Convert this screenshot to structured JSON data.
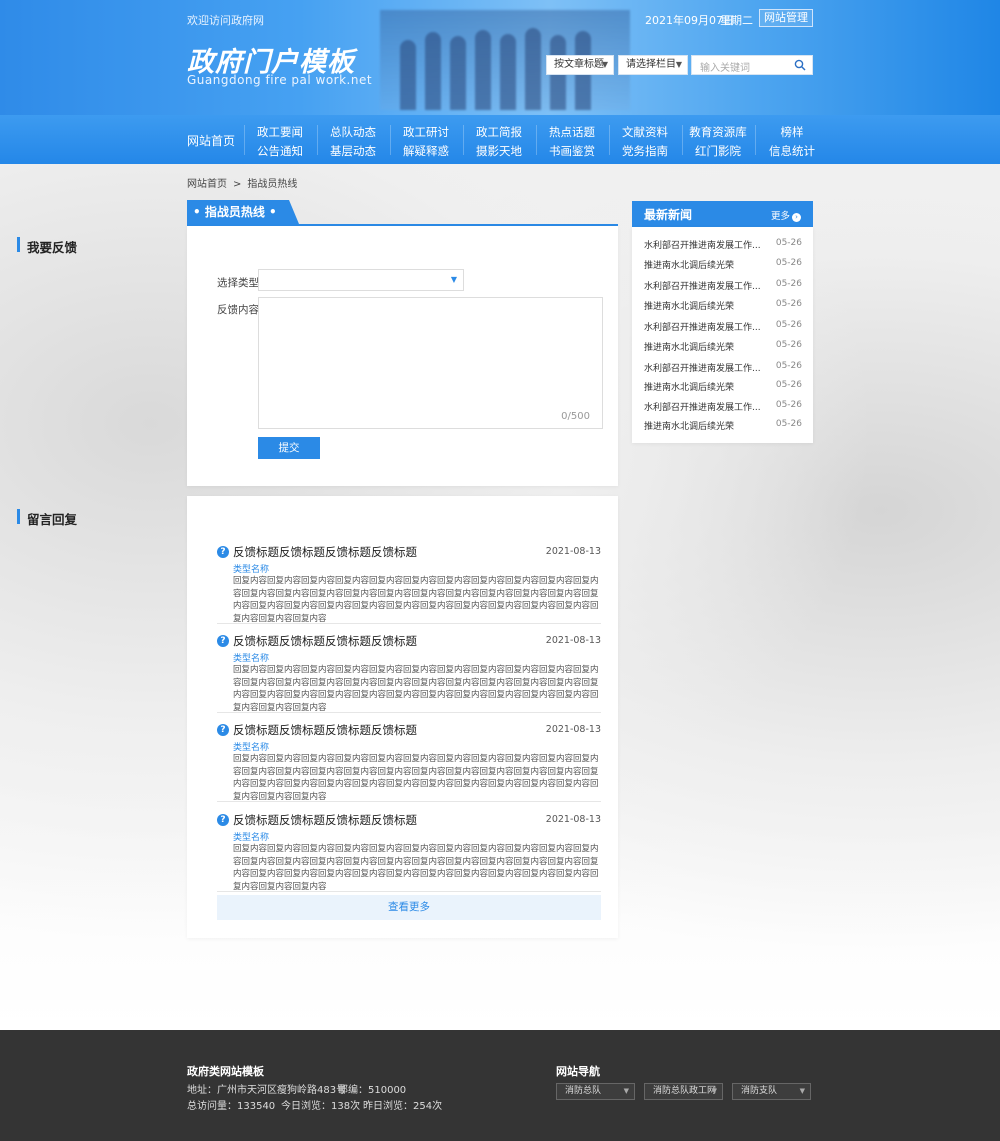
{
  "header": {
    "welcome": "欢迎访问政府网",
    "site_title": "政府门户模板",
    "site_subtitle": "Guangdong fire pal work.net",
    "date": "2021年09月07日",
    "weekday": "星期二",
    "admin_button": "网站管理",
    "select_article_title": "按文章标题",
    "select_column": "请选择栏目",
    "search_placeholder": "输入关键词"
  },
  "nav": {
    "home": "网站首页",
    "columns": [
      {
        "top": "政工要闻",
        "bottom": "公告通知"
      },
      {
        "top": "总队动态",
        "bottom": "基层动态"
      },
      {
        "top": "政工研讨",
        "bottom": "解疑释惑"
      },
      {
        "top": "政工简报",
        "bottom": "摄影天地"
      },
      {
        "top": "热点话题",
        "bottom": "书画鉴赏"
      },
      {
        "top": "文献资料",
        "bottom": "党务指南"
      },
      {
        "top": "教育资源库",
        "bottom": "红门影院"
      },
      {
        "top": "榜样",
        "bottom": "信息统计"
      }
    ]
  },
  "breadcrumb": {
    "home": "网站首页",
    "separator": ">",
    "current": "指战员热线"
  },
  "hotline": {
    "tab": "• 指战员热线 •",
    "feedback_title": "我要反馈",
    "type_label": "选择类型",
    "content_label": "反馈内容",
    "counter": "0/500",
    "submit": "提交"
  },
  "replies": {
    "title": "留言回复",
    "items": [
      {
        "title": "反馈标题反馈标题反馈标题反馈标题",
        "date": "2021-08-13",
        "type": "类型名称",
        "body": "回复内容回复内容回复内容回复内容回复内容回复内容回复内容回复内容回复内容回复内容回复内容回复内容回复内容回复内容回复内容回复内容回复内容回复内容回复内容回复内容回复内容回复内容回复内容回复内容回复内容回复内容回复内容回复内容回复内容回复内容回复内容回复内容回复内容回复内容回复内容"
      },
      {
        "title": "反馈标题反馈标题反馈标题反馈标题",
        "date": "2021-08-13",
        "type": "类型名称",
        "body": "回复内容回复内容回复内容回复内容回复内容回复内容回复内容回复内容回复内容回复内容回复内容回复内容回复内容回复内容回复内容回复内容回复内容回复内容回复内容回复内容回复内容回复内容回复内容回复内容回复内容回复内容回复内容回复内容回复内容回复内容回复内容回复内容回复内容回复内容回复内容"
      },
      {
        "title": "反馈标题反馈标题反馈标题反馈标题",
        "date": "2021-08-13",
        "type": "类型名称",
        "body": "回复内容回复内容回复内容回复内容回复内容回复内容回复内容回复内容回复内容回复内容回复内容回复内容回复内容回复内容回复内容回复内容回复内容回复内容回复内容回复内容回复内容回复内容回复内容回复内容回复内容回复内容回复内容回复内容回复内容回复内容回复内容回复内容回复内容回复内容回复内容"
      },
      {
        "title": "反馈标题反馈标题反馈标题反馈标题",
        "date": "2021-08-13",
        "type": "类型名称",
        "body": "回复内容回复内容回复内容回复内容回复内容回复内容回复内容回复内容回复内容回复内容回复内容回复内容回复内容回复内容回复内容回复内容回复内容回复内容回复内容回复内容回复内容回复内容回复内容回复内容回复内容回复内容回复内容回复内容回复内容回复内容回复内容回复内容回复内容回复内容回复内容"
      }
    ],
    "more": "查看更多"
  },
  "news": {
    "title": "最新新闻",
    "more": "更多",
    "items": [
      {
        "title": "水利部召开推进南发展工作...",
        "date": "05-26"
      },
      {
        "title": "推进南水北调后续光荣",
        "date": "05-26"
      },
      {
        "title": "水利部召开推进南发展工作...",
        "date": "05-26"
      },
      {
        "title": "推进南水北调后续光荣",
        "date": "05-26"
      },
      {
        "title": "水利部召开推进南发展工作...",
        "date": "05-26"
      },
      {
        "title": "推进南水北调后续光荣",
        "date": "05-26"
      },
      {
        "title": "水利部召开推进南发展工作...",
        "date": "05-26"
      },
      {
        "title": "推进南水北调后续光荣",
        "date": "05-26"
      },
      {
        "title": "水利部召开推进南发展工作...",
        "date": "05-26"
      },
      {
        "title": "推进南水北调后续光荣",
        "date": "05-26"
      }
    ]
  },
  "footer": {
    "title": "政府类网站模板",
    "address": "地址：广州市天河区瘦狗岭路483号",
    "postcode": "邮编：510000",
    "total_visits": "总访问量：133540",
    "today_visits": "今日浏览：138次",
    "yesterday_visits": "昨日浏览：254次",
    "nav_title": "网站导航",
    "nav_selects": [
      "消防总队",
      "消防总队政工网",
      "消防支队"
    ]
  },
  "colors": {
    "primary": "#2b8ae6",
    "footer_bg": "#343434"
  }
}
